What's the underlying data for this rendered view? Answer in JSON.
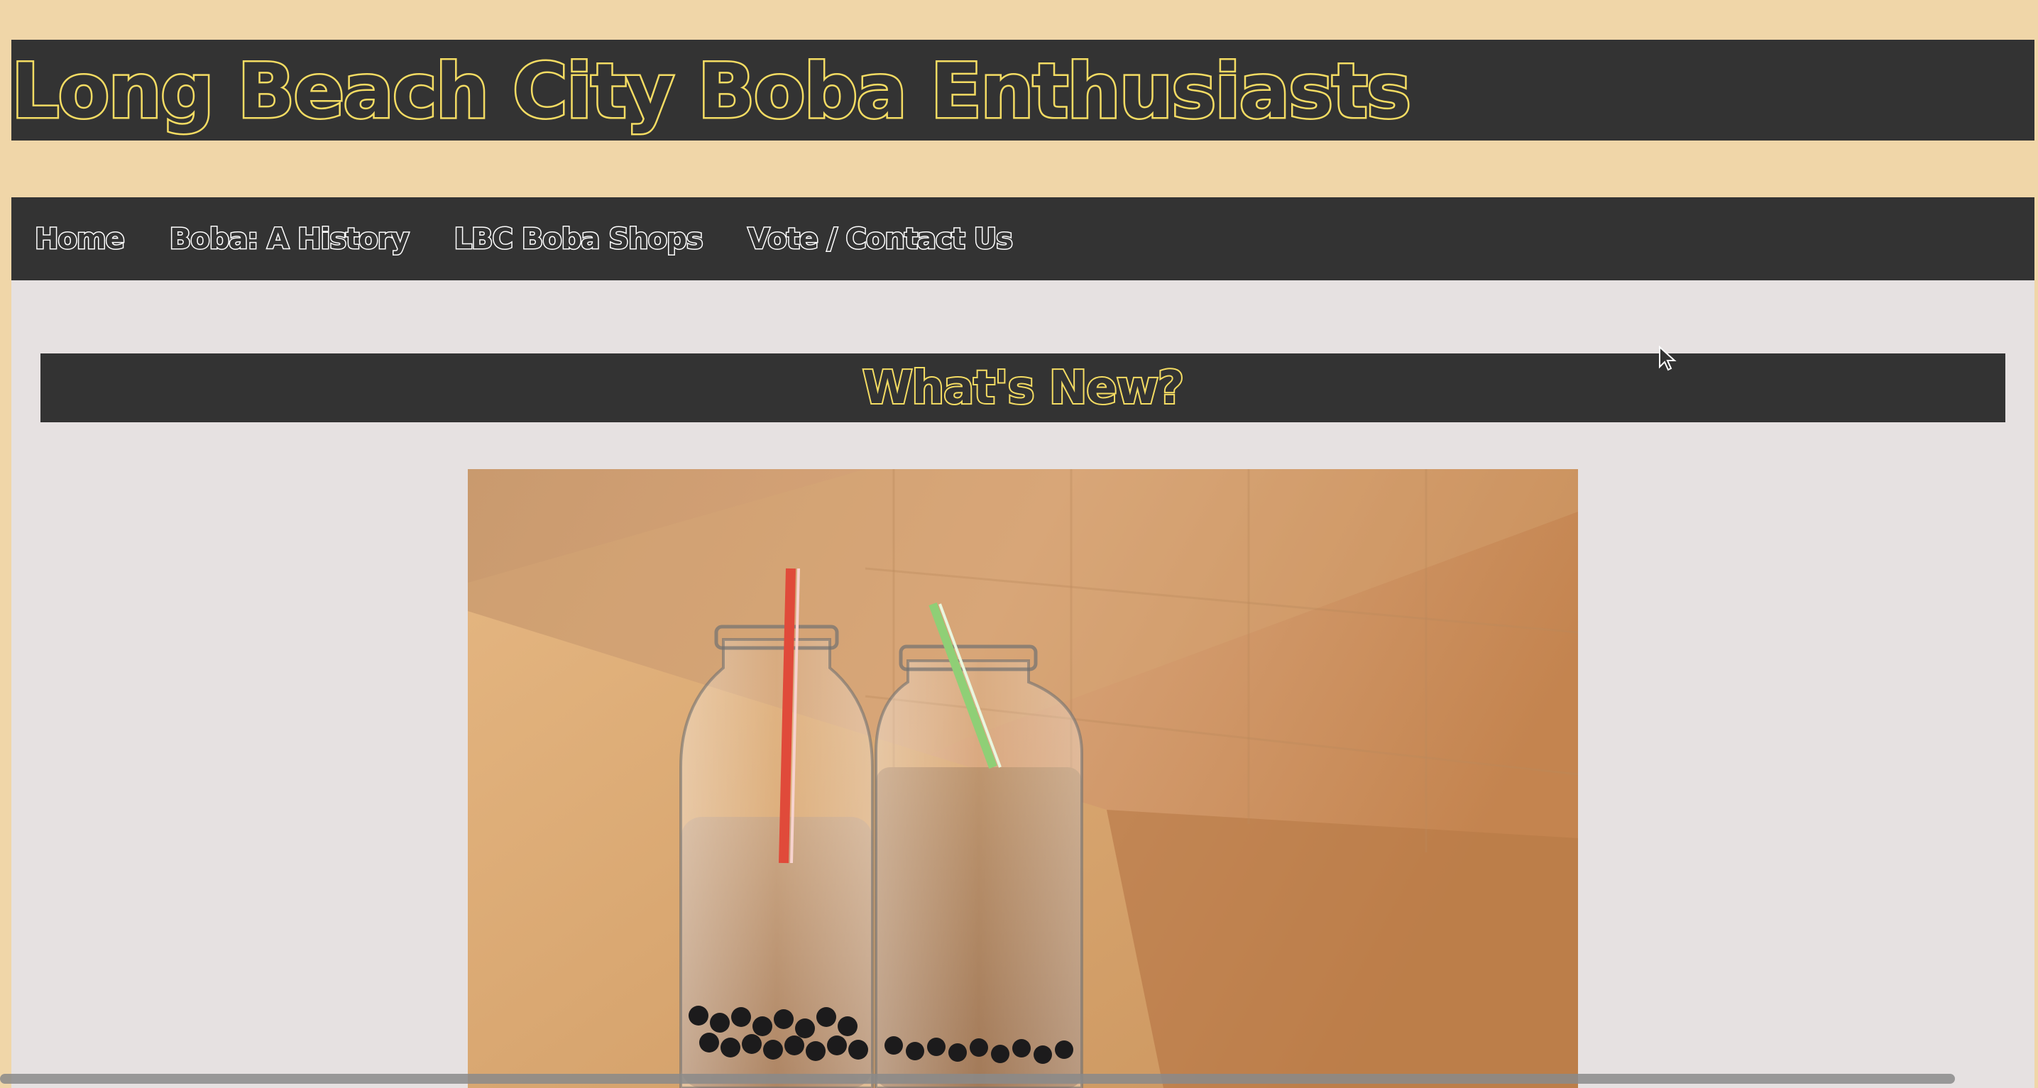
{
  "header": {
    "site_title": "Long Beach City Boba Enthusiasts"
  },
  "nav": {
    "items": [
      {
        "label": "Home"
      },
      {
        "label": "Boba: A History"
      },
      {
        "label": "LBC Boba Shops"
      },
      {
        "label": "Vote / Contact Us"
      }
    ]
  },
  "main": {
    "section_title": "What's New?",
    "featured_image_icon": "boba-drinks-photo"
  },
  "colors": {
    "page_background": "#f0d6a8",
    "bar_background": "#333333",
    "title_outline": "#f4dc63",
    "nav_outline": "#ffffff",
    "content_background": "#e6e1e1"
  }
}
